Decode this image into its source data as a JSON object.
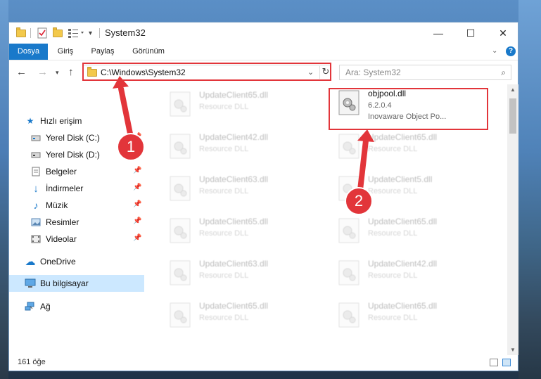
{
  "window": {
    "title": "System32",
    "controls": {
      "minimize": "—",
      "maximize": "☐",
      "close": "✕"
    }
  },
  "ribbon": {
    "tabs": [
      "Dosya",
      "Giriş",
      "Paylaş",
      "Görünüm"
    ]
  },
  "nav": {
    "address": "C:\\Windows\\System32",
    "search_placeholder": "Ara: System32"
  },
  "sidebar": {
    "quick_access": "Hızlı erişim",
    "items": [
      {
        "label": "Yerel Disk (C:)",
        "icon": "drive-icon",
        "pinned": true
      },
      {
        "label": "Yerel Disk (D:)",
        "icon": "drive-icon",
        "pinned": true
      },
      {
        "label": "Belgeler",
        "icon": "documents-icon",
        "pinned": true
      },
      {
        "label": "İndirmeler",
        "icon": "downloads-icon",
        "pinned": true
      },
      {
        "label": "Müzik",
        "icon": "music-icon",
        "pinned": true
      },
      {
        "label": "Resimler",
        "icon": "pictures-icon",
        "pinned": true
      },
      {
        "label": "Videolar",
        "icon": "videos-icon",
        "pinned": true
      }
    ],
    "onedrive": "OneDrive",
    "this_pc": "Bu bilgisayar",
    "network": "Ağ"
  },
  "files": {
    "highlighted": {
      "name": "objpool.dll",
      "version": "6.2.0.4",
      "company": "Inovaware Object Po..."
    },
    "left_column": [
      {
        "name": "UpdateClient65.dll",
        "type": "Resource DLL"
      },
      {
        "name": "UpdateClient42.dll",
        "type": "Resource DLL"
      },
      {
        "name": "UpdateClient63.dll",
        "type": "Resource DLL"
      },
      {
        "name": "UpdateClient65.dll",
        "type": "Resource DLL"
      },
      {
        "name": "UpdateClient63.dll",
        "type": "Resource DLL"
      },
      {
        "name": "UpdateClient65.dll",
        "type": "Resource DLL"
      }
    ],
    "right_column": [
      {
        "name": "UpdateClient65.dll",
        "type": "Resource DLL"
      },
      {
        "name": "UpdateClient5.dll",
        "type": "Resource DLL"
      },
      {
        "name": "UpdateClient65.dll",
        "type": "Resource DLL"
      },
      {
        "name": "UpdateClient42.dll",
        "type": "Resource DLL"
      },
      {
        "name": "UpdateClient65.dll",
        "type": "Resource DLL"
      }
    ]
  },
  "status": {
    "item_count": "161 öğe"
  },
  "annotations": {
    "badge1": "1",
    "badge2": "2",
    "color": "#e2353a"
  }
}
